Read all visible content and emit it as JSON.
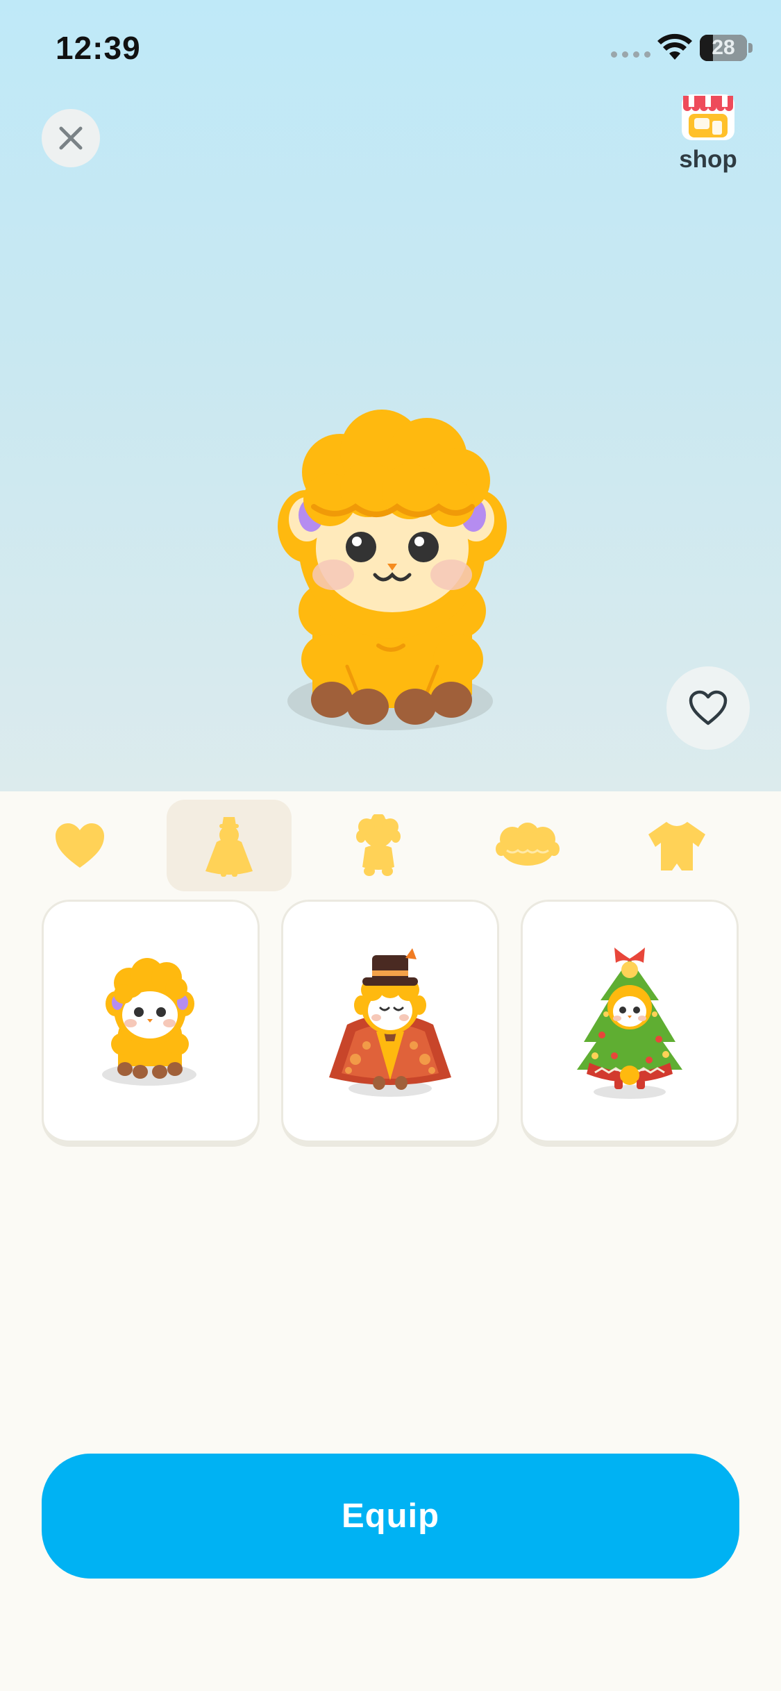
{
  "status_bar": {
    "time": "12:39",
    "battery_percent": "28",
    "battery_level": 0.28
  },
  "header": {
    "close_icon": "close-icon",
    "shop_label": "shop",
    "shop_icon": "storefront-icon"
  },
  "preview": {
    "mascot": "orange-sheep-mascot",
    "favorite_icon": "heart-outline-icon"
  },
  "tabs": [
    {
      "icon": "heart-icon",
      "selected": false
    },
    {
      "icon": "full-outfit-silhouette-icon",
      "selected": true
    },
    {
      "icon": "sheep-body-silhouette-icon",
      "selected": false
    },
    {
      "icon": "wool-hair-icon",
      "selected": false
    },
    {
      "icon": "clothing-shirt-icon",
      "selected": false
    }
  ],
  "items": [
    {
      "name": "default-orange-sheep"
    },
    {
      "name": "pilgrim-autumn-costume"
    },
    {
      "name": "christmas-tree-costume"
    }
  ],
  "actions": {
    "equip_label": "Equip"
  },
  "colors": {
    "accent": "#00b2f3",
    "wool": "#ffb90f",
    "tab_icon": "#ffd257"
  }
}
